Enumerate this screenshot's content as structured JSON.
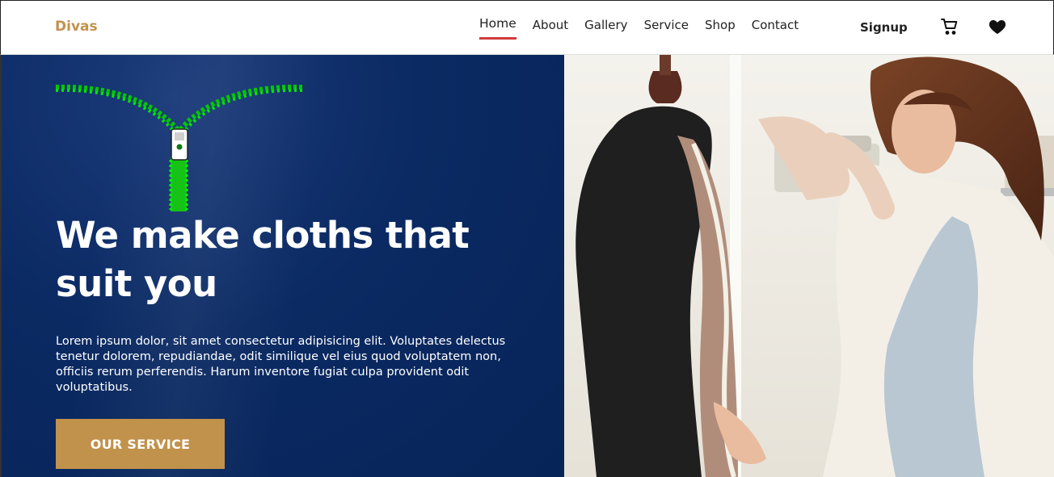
{
  "brand": {
    "name": "Divas",
    "color": "#c1924b"
  },
  "nav": {
    "items": [
      {
        "label": "Home",
        "active": true
      },
      {
        "label": "About"
      },
      {
        "label": "Gallery"
      },
      {
        "label": "Service"
      },
      {
        "label": "Shop"
      },
      {
        "label": "Contact"
      }
    ],
    "signup_label": "Signup",
    "icons": [
      "cart-icon",
      "heart-icon"
    ],
    "active_underline_color": "#d23b3b"
  },
  "hero": {
    "headline": "We make cloths that suit you",
    "description": "Lorem ipsum dolor, sit amet consectetur adipisicing elit. Voluptates delectus tenetur dolorem, repudiandae, odit similique vel eius quod voluptatem non, officiis rerum perferendis. Harum inventore fugiat culpa provident odit voluptatibus.",
    "cta_label": "OUR SERVICE",
    "cta_color": "#c1924b",
    "background_color": "#0b2a63",
    "decor_icon": "zipper-icon",
    "image": "tailor-with-mannequin-photo"
  }
}
